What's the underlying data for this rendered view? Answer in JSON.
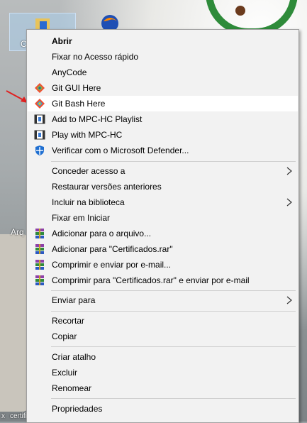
{
  "desktop": {
    "label_partial_1": "C",
    "label_partial_2": "Arq",
    "label_partial_3": "x",
    "label_partial_4": "certificados"
  },
  "context_menu": {
    "items": [
      {
        "label": "Abrir",
        "bold": true
      },
      {
        "label": "Fixar no Acesso rápido"
      },
      {
        "label": "AnyCode"
      },
      {
        "label": "Git GUI Here",
        "icon": "git-gui-icon"
      },
      {
        "label": "Git Bash Here",
        "icon": "git-bash-icon",
        "highlighted": true
      },
      {
        "label": "Add to MPC-HC Playlist",
        "icon": "mpc-hc-icon"
      },
      {
        "label": "Play with MPC-HC",
        "icon": "mpc-hc-icon"
      },
      {
        "label": "Verificar com o Microsoft Defender...",
        "icon": "defender-shield-icon"
      },
      {
        "label": "Conceder acesso a",
        "submenu": true
      },
      {
        "label": "Restaurar versões anteriores"
      },
      {
        "label": "Incluir na biblioteca",
        "submenu": true
      },
      {
        "label": "Fixar em Iniciar"
      },
      {
        "label": "Adicionar para o arquivo...",
        "icon": "winrar-icon"
      },
      {
        "label": "Adicionar para \"Certificados.rar\"",
        "icon": "winrar-icon"
      },
      {
        "label": "Comprimir e enviar por e-mail...",
        "icon": "winrar-icon"
      },
      {
        "label": "Comprimir para \"Certificados.rar\" e enviar por e-mail",
        "icon": "winrar-icon"
      },
      {
        "label": "Enviar para",
        "submenu": true
      },
      {
        "label": "Recortar"
      },
      {
        "label": "Copiar"
      },
      {
        "label": "Criar atalho"
      },
      {
        "label": "Excluir"
      },
      {
        "label": "Renomear"
      },
      {
        "label": "Propriedades"
      }
    ]
  },
  "colors": {
    "menu_bg": "#f2f2f2",
    "hover_bg": "#ffffff",
    "annotation_arrow": "#e02020"
  }
}
